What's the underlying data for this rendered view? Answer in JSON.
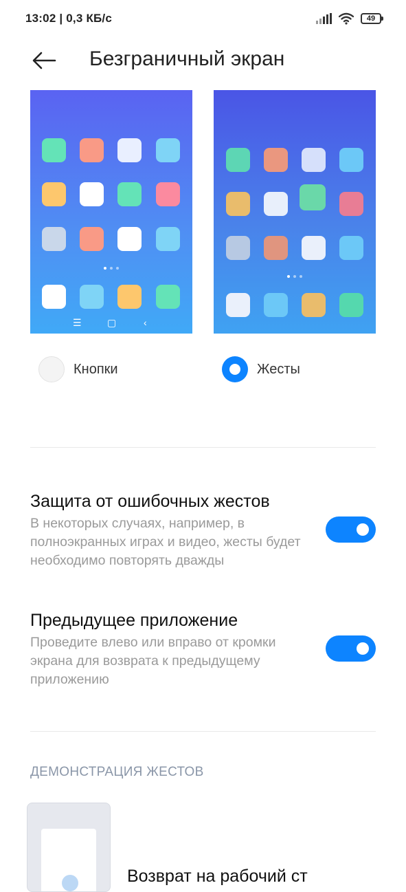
{
  "status_bar": {
    "time_speed": "13:02 | 0,3 КБ/с",
    "battery": "49",
    "icons": [
      "signal-icon",
      "wifi-icon",
      "battery-icon"
    ]
  },
  "header": {
    "back_icon": "arrow-left-icon",
    "title": "Безграничный экран"
  },
  "options": [
    {
      "label": "Кнопки",
      "selected": false
    },
    {
      "label": "Жесты",
      "selected": true
    }
  ],
  "settings": [
    {
      "title": "Защита от ошибочных жестов",
      "description": "В некоторых случаях, например, в полноэкранных играх и видео, жесты будет необходимо повторять дважды",
      "enabled": true
    },
    {
      "title": "Предыдущее приложение",
      "description": "Проведите влево или вправо от кромки экрана для возврата к предыдущему приложению",
      "enabled": true
    }
  ],
  "demo": {
    "section_title": "ДЕМОНСТРАЦИЯ ЖЕСТОВ",
    "item_label": "Возврат на рабочий ст"
  },
  "colors": {
    "accent": "#0d84ff",
    "preview_left_top": "#5a63f2",
    "preview_right_top": "#4a55e6"
  }
}
